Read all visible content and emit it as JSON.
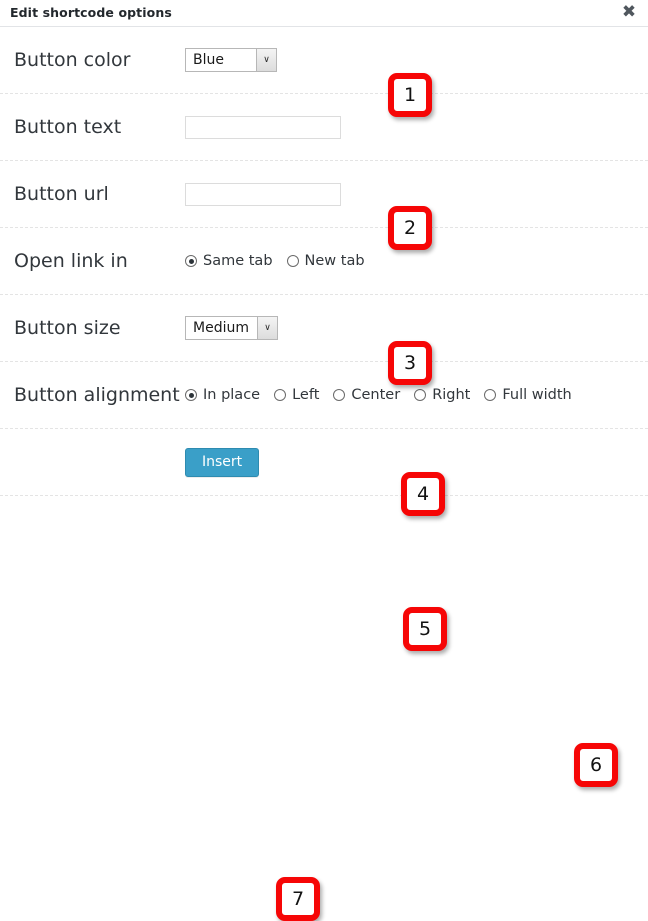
{
  "dialog": {
    "title": "Edit shortcode options",
    "close_icon": "close-icon",
    "close_glyph": "✖"
  },
  "rows": [
    {
      "label": "Button color",
      "type": "select",
      "value": "Blue",
      "arrow_glyph": "∨",
      "badge": "1"
    },
    {
      "label": "Button text",
      "type": "text",
      "value": "",
      "placeholder": "",
      "badge": "2"
    },
    {
      "label": "Button url",
      "type": "text",
      "value": "",
      "placeholder": "",
      "badge": "3"
    },
    {
      "label": "Open link in",
      "type": "radio",
      "options": [
        {
          "label": "Same tab",
          "checked": true
        },
        {
          "label": "New tab",
          "checked": false
        }
      ],
      "badge": "4"
    },
    {
      "label": "Button size",
      "type": "select",
      "value": "Medium",
      "arrow_glyph": "∨",
      "badge": "5"
    },
    {
      "label": "Button alignment",
      "type": "radio",
      "options": [
        {
          "label": "In place",
          "checked": true
        },
        {
          "label": "Left",
          "checked": false
        },
        {
          "label": "Center",
          "checked": false
        },
        {
          "label": "Right",
          "checked": false
        },
        {
          "label": "Full width",
          "checked": false
        }
      ],
      "badge": "6"
    }
  ],
  "submit": {
    "label": "Insert",
    "badge": "7"
  },
  "colors": {
    "badge_border": "#f60606",
    "insert_button": "#3a9fc8",
    "label_text": "#32373c",
    "title_text": "#23282d"
  }
}
